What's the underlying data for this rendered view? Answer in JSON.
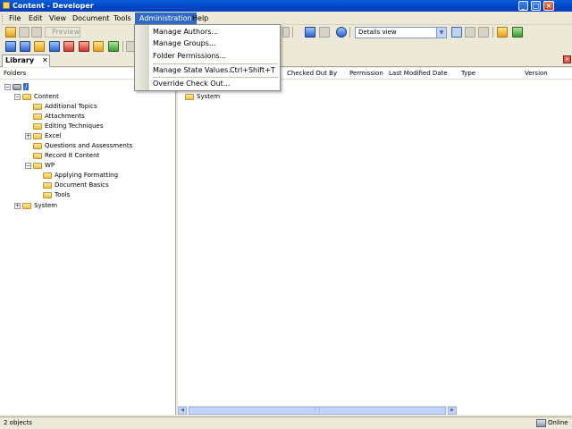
{
  "window": {
    "title": "Content - Developer"
  },
  "menu": {
    "items": [
      "File",
      "Edit",
      "View",
      "Document",
      "Tools",
      "Administration",
      "Help"
    ],
    "active": "Administration"
  },
  "toolbar": {
    "preview_label": "Preview",
    "view_select": "Details view"
  },
  "tab": {
    "label": "Library",
    "close": "✕"
  },
  "admin_menu": {
    "items": [
      {
        "label": "Manage Authors..."
      },
      {
        "label": "Manage Groups..."
      },
      {
        "label": "Folder Permissions..."
      },
      {
        "label": "Manage State Values...",
        "shortcut": "Ctrl+Shift+T"
      },
      {
        "label": "Override Check Out..."
      }
    ]
  },
  "left_pane": {
    "header": "Folders",
    "tree": {
      "root": "/",
      "content": "Content",
      "content_children": [
        "Additional Topics",
        "Attachments",
        "Editing Techniques",
        "Excel",
        "Questions and Assessments",
        "Record It Content",
        "WP"
      ],
      "wp_children": [
        "Applying Formatting",
        "Document Basics",
        "Tools"
      ],
      "system": "System"
    }
  },
  "right_pane": {
    "columns": [
      "Checked Out By",
      "Permission",
      "Last Modified Date",
      "Type",
      "Version"
    ],
    "rows": [
      "System"
    ]
  },
  "status": {
    "count": "2 objects",
    "connection": "Online"
  }
}
